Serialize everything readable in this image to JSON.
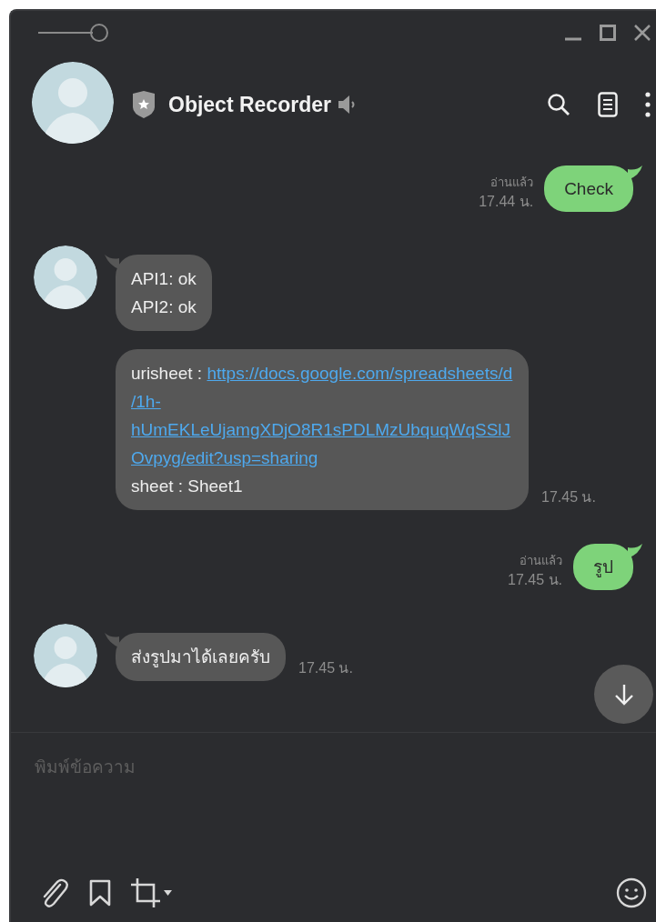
{
  "chat": {
    "title": "Object Recorder"
  },
  "messages": [
    {
      "kind": "outgoing",
      "text": "Check",
      "read": "อ่านแล้ว",
      "time": "17.44 น."
    },
    {
      "kind": "incoming",
      "avatar": true,
      "parts": [
        {
          "kind": "text",
          "text": "API1: ok\nAPI2: ok"
        }
      ]
    },
    {
      "kind": "incoming",
      "avatar": false,
      "parts": [
        {
          "kind": "text",
          "text": "urisheet : "
        },
        {
          "kind": "link",
          "text": "https://docs.google.com/spreadsheets/d/1h-hUmEKLeUjamgXDjO8R1sPDLMzUbquqWqSSlJOvpyg/edit?usp=sharing"
        },
        {
          "kind": "text",
          "text": "sheet : Sheet1"
        }
      ],
      "time": "17.45 น."
    },
    {
      "kind": "outgoing",
      "text": "รูป",
      "read": "อ่านแล้ว",
      "time": "17.45 น."
    },
    {
      "kind": "incoming",
      "avatar": true,
      "parts": [
        {
          "kind": "text",
          "text": "ส่งรูปมาได้เลยครับ"
        }
      ],
      "time": "17.45 น."
    }
  ],
  "composer": {
    "placeholder": "พิมพ์ข้อความ"
  }
}
